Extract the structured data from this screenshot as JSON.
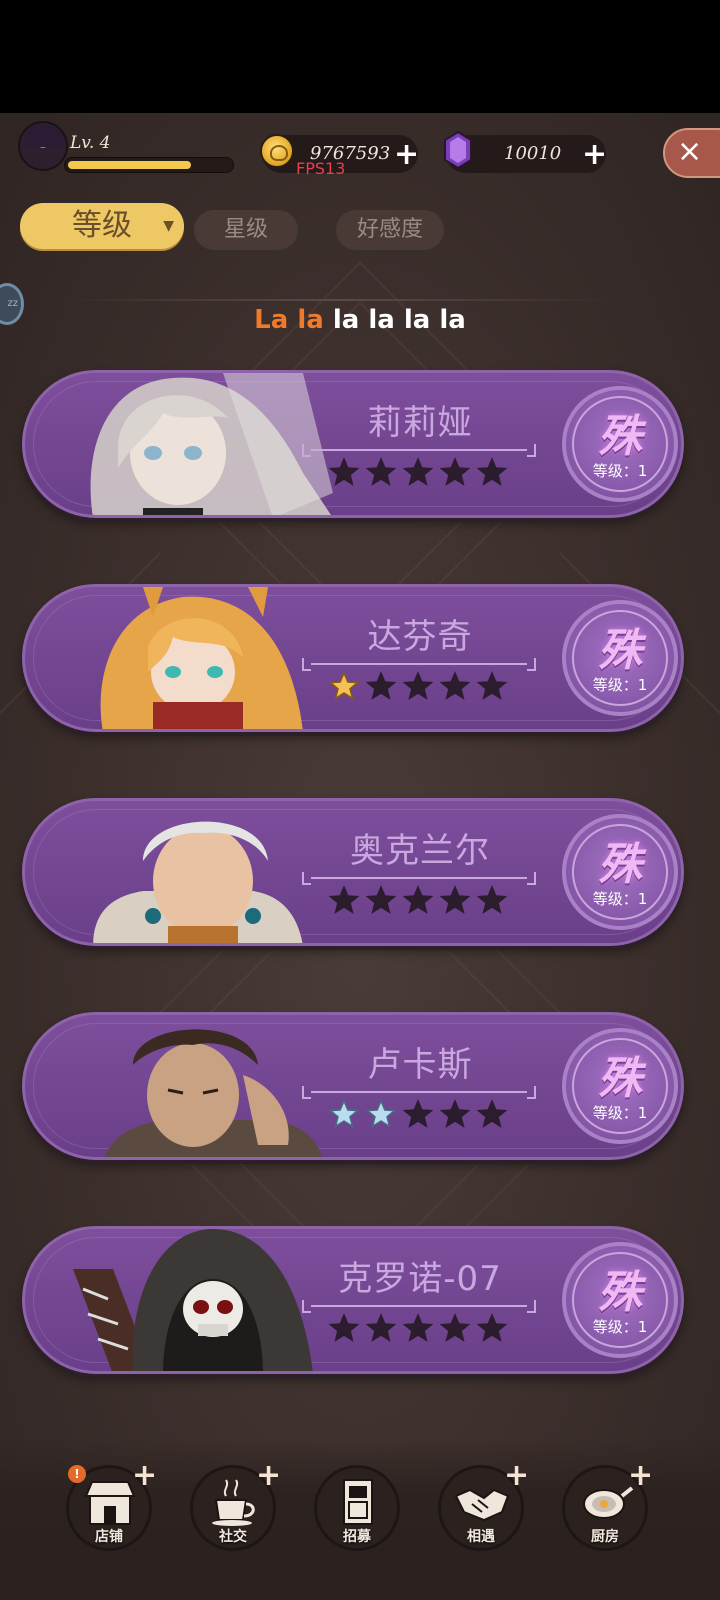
{
  "player": {
    "level_label": "Lv. 4",
    "xp_fraction": 0.75
  },
  "currency": {
    "coins": "9767593",
    "gems": "10010",
    "fps": "FPS13"
  },
  "close_label": "×",
  "tabs": [
    {
      "label": "等级",
      "active": true
    },
    {
      "label": "星级",
      "active": false
    },
    {
      "label": "好感度",
      "active": false
    }
  ],
  "side_bubble": "zz",
  "banner": {
    "part1": "La la",
    "part2": "la la la la"
  },
  "characters": [
    {
      "name": "莉莉娅",
      "stars": 0,
      "star_color": "none",
      "rank": "殊",
      "level": "等级：1"
    },
    {
      "name": "达芬奇",
      "stars": 1,
      "star_color": "gold",
      "rank": "殊",
      "level": "等级：1"
    },
    {
      "name": "奥克兰尔",
      "stars": 0,
      "star_color": "none",
      "rank": "殊",
      "level": "等级：1"
    },
    {
      "name": "卢卡斯",
      "stars": 2,
      "star_color": "blue",
      "rank": "殊",
      "level": "等级：1"
    },
    {
      "name": "克罗诺-07",
      "stars": 0,
      "star_color": "none",
      "rank": "殊",
      "level": "等级：1"
    }
  ],
  "nav": [
    {
      "label": "店铺",
      "icon": "shop-icon"
    },
    {
      "label": "社交",
      "icon": "coffee-cup-icon"
    },
    {
      "label": "招募",
      "icon": "door-icon"
    },
    {
      "label": "相遇",
      "icon": "handshake-icon"
    },
    {
      "label": "厨房",
      "icon": "frying-pan-icon"
    }
  ],
  "colors": {
    "accent_gold": "#edc865",
    "card_purple": "#6a3f89",
    "rank_pink": "#f0b8f4",
    "bg": "#3d302d"
  }
}
